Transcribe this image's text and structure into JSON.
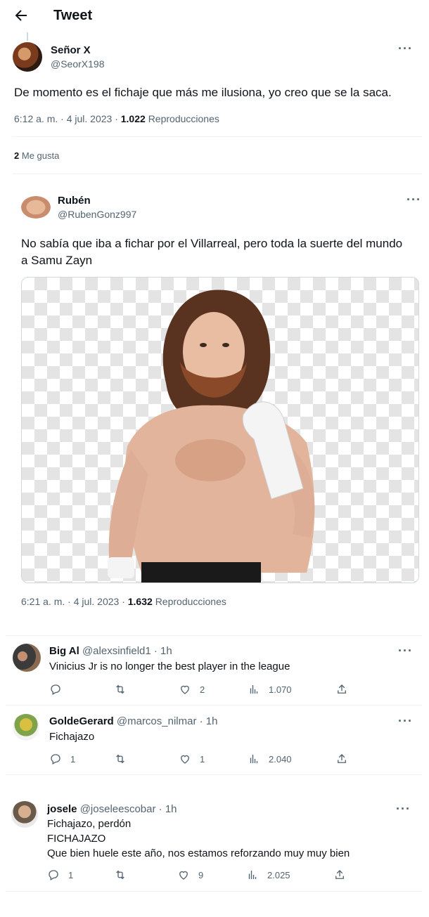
{
  "header": {
    "title": "Tweet"
  },
  "main_tweet": {
    "author_name": "Señor X",
    "author_handle": "@SeorX198",
    "text": "De momento es el fichaje que más me ilusiona, yo creo que se la saca.",
    "time": "6:12 a. m. · 4 jul. 2023 ·",
    "views_count": "1.022",
    "views_label": "Reproducciones",
    "likes_count": "2",
    "likes_label": "Me gusta"
  },
  "quoted_tweet": {
    "author_name": "Rubén",
    "author_handle": "@RubenGonz997",
    "text_line1": "No sabía que iba a fichar por el Villarreal, pero toda la suerte del mundo",
    "text_line2": "a Samu Zayn",
    "time": "6:21 a. m. · 4 jul. 2023 ·",
    "views_count": "1.632",
    "views_label": "Reproducciones"
  },
  "replies": [
    {
      "name": "Big Al",
      "handle": "@alexsinfield1 · 1h",
      "lines": [
        "Vinicius Jr is no longer the best player in the league"
      ],
      "replies": "",
      "likes": "2",
      "views": "1.070"
    },
    {
      "name": "GoldeGerard",
      "handle": "@marcos_nilmar · 1h",
      "lines": [
        "Fichajazo"
      ],
      "replies": "1",
      "likes": "1",
      "views": "2.040"
    },
    {
      "name": "josele",
      "handle": "@joseleescobar · 1h",
      "lines": [
        "Fichajazo, perdón",
        "FICHAJAZO",
        "Que bien huele este año, nos estamos reforzando muy muy bien"
      ],
      "replies": "1",
      "likes": "9",
      "views": "2.025"
    }
  ],
  "icons": {
    "back": "arrow-left-icon",
    "more": "more-dots-icon",
    "reply": "comment-icon",
    "retweet": "retweet-icon",
    "like": "heart-icon",
    "views": "bar-chart-icon",
    "share": "share-icon"
  },
  "colors": {
    "text": "#0f1419",
    "muted": "#536471",
    "divider": "#eff3f4"
  }
}
